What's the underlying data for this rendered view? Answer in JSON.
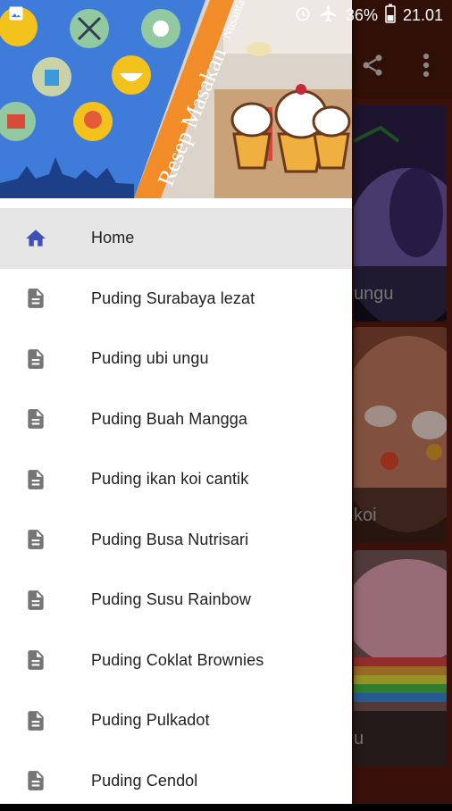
{
  "status_bar": {
    "battery": "36%",
    "time": "21.01"
  },
  "header": {
    "banner_text": "Resep Masakan",
    "banner_subtext": "Nusantara"
  },
  "menu": {
    "items": [
      {
        "label": "Home",
        "icon": "home-icon",
        "active": true
      },
      {
        "label": "Puding Surabaya lezat",
        "icon": "document-icon"
      },
      {
        "label": "Puding ubi ungu",
        "icon": "document-icon"
      },
      {
        "label": "Puding Buah Mangga",
        "icon": "document-icon"
      },
      {
        "label": "Puding ikan koi cantik",
        "icon": "document-icon"
      },
      {
        "label": "Puding Busa Nutrisari",
        "icon": "document-icon"
      },
      {
        "label": "Puding Susu Rainbow",
        "icon": "document-icon"
      },
      {
        "label": "Puding Coklat Brownies",
        "icon": "document-icon"
      },
      {
        "label": "Puding Pulkadot",
        "icon": "document-icon"
      },
      {
        "label": "Puding Cendol",
        "icon": "document-icon"
      }
    ]
  },
  "background": {
    "cards": [
      {
        "caption": "ungu"
      },
      {
        "caption": "koi"
      },
      {
        "caption": "u"
      }
    ]
  },
  "colors": {
    "accent": "#3f51b5",
    "header_blue": "#3f7bd8",
    "banner_orange": "#f28c28",
    "app_bg": "#5a1a10"
  }
}
